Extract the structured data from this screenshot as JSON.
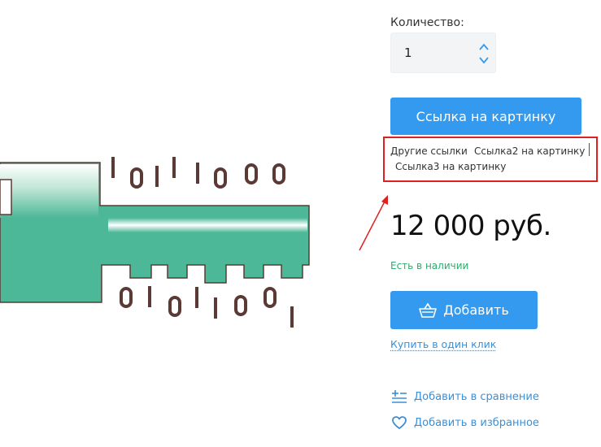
{
  "quantity": {
    "label": "Количество:",
    "value": "1"
  },
  "image_link_button": {
    "label": "Ссылка на картинку"
  },
  "other_links": {
    "label": "Другие ссылки",
    "link2": "Ссылка2 на картинку",
    "link3": "Ссылка3 на картинку"
  },
  "price": {
    "text": "12 000 руб."
  },
  "stock": {
    "text": "Есть в наличии"
  },
  "cart": {
    "add_label": "Добавить",
    "one_click_label": "Купить в один клик"
  },
  "actions": {
    "compare_label": "Добавить в сравнение",
    "favorite_label": "Добавить в избранное"
  },
  "colors": {
    "accent": "#339af0",
    "link": "#3a8fd8",
    "stock": "#2eab6c",
    "annotation": "#e02020",
    "key_teal": "#4cb897",
    "key_digits": "#5b3a36"
  },
  "icons": {
    "arrow_up": "chevron-up-icon",
    "arrow_down": "chevron-down-icon",
    "cart": "basket-icon",
    "compare": "compare-list-icon",
    "favorite": "heart-icon",
    "annotation": "annotation-arrow-icon"
  },
  "illustration": {
    "binary_top": [
      "1",
      "0",
      "1",
      "1",
      "1",
      "0",
      "0",
      "0"
    ],
    "binary_bottom": [
      "0",
      "1",
      "0",
      "1",
      "1",
      "0",
      "0",
      "1"
    ]
  }
}
